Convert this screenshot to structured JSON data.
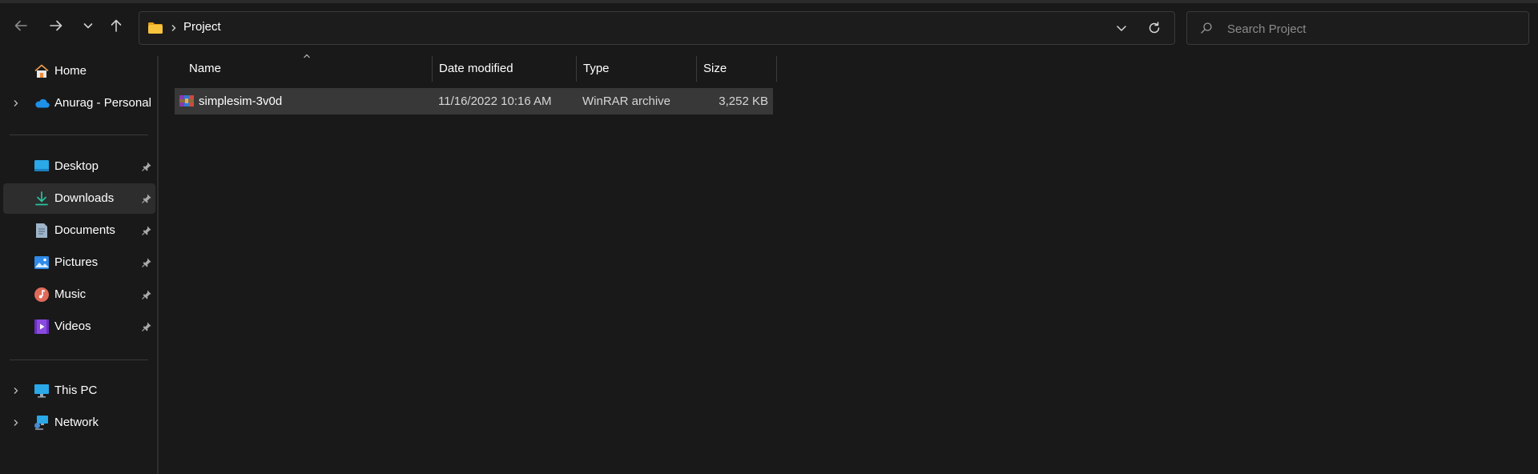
{
  "address_bar": {
    "path": [
      "Project"
    ],
    "refresh_icon": "refresh-icon",
    "dropdown_icon": "chevron-down-icon"
  },
  "search": {
    "placeholder": "Search Project"
  },
  "nav": {
    "back_icon": "arrow-left-icon",
    "forward_icon": "arrow-right-icon",
    "recent_icon": "chevron-down-icon",
    "up_icon": "arrow-up-icon"
  },
  "sidebar": {
    "items": [
      {
        "label": "Home",
        "icon": "home-icon"
      },
      {
        "label": "Anurag - Personal",
        "icon": "onedrive-cloud-icon",
        "expandable": true
      },
      {
        "label": "Desktop",
        "icon": "desktop-icon",
        "pinned": true
      },
      {
        "label": "Downloads",
        "icon": "downloads-icon",
        "pinned": true,
        "selected": true
      },
      {
        "label": "Documents",
        "icon": "documents-icon",
        "pinned": true
      },
      {
        "label": "Pictures",
        "icon": "pictures-icon",
        "pinned": true
      },
      {
        "label": "Music",
        "icon": "music-icon",
        "pinned": true
      },
      {
        "label": "Videos",
        "icon": "videos-icon",
        "pinned": true
      },
      {
        "label": "This PC",
        "icon": "this-pc-icon",
        "expandable": true
      },
      {
        "label": "Network",
        "icon": "network-icon",
        "expandable": true
      }
    ]
  },
  "file_list": {
    "columns": [
      "Name",
      "Date modified",
      "Type",
      "Size"
    ],
    "sort_column": "Name",
    "rows": [
      {
        "name": "simplesim-3v0d",
        "date_modified": "11/16/2022 10:16 AM",
        "type": "WinRAR archive",
        "size": "3,252 KB",
        "icon": "winrar-archive-icon",
        "selected": true
      }
    ]
  },
  "colors": {
    "background": "#191919",
    "selected_row": "#383838",
    "selected_sidebar": "#2d2d2d",
    "folder_accent": "#f8c33c",
    "text": "#ffffff",
    "placeholder": "#8b8b8b"
  }
}
